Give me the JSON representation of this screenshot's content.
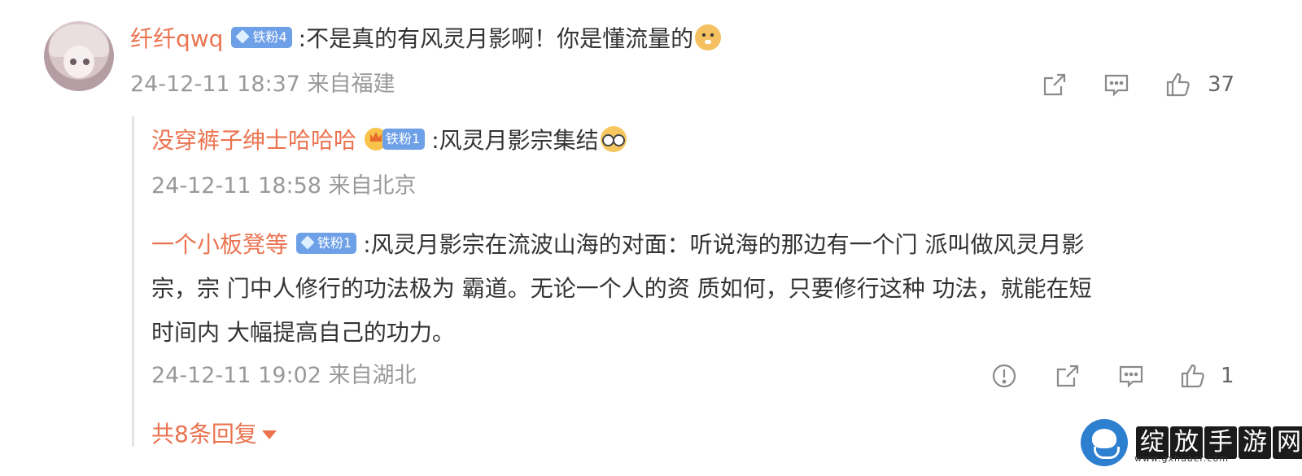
{
  "comment": {
    "username": "纤纤qwq",
    "badge": "铁粉4",
    "text": ":不是真的有风灵月影啊！你是懂流量的",
    "meta": "24-12-11 18:37 来自福建",
    "like_count": "37"
  },
  "replies": [
    {
      "username": "没穿裤子绅士哈哈哈",
      "badge": "铁粉1",
      "text": ":风灵月影宗集结",
      "meta": "24-12-11 18:58 来自北京"
    },
    {
      "username": "一个小板凳等",
      "badge": "铁粉1",
      "text_lines": [
        ":风灵月影宗在流波山海的对面：听说海的那边有一个门 派叫做风灵月影",
        "宗，宗 门中人修行的功法极为 霸道。无论一个人的资 质如何，只要修行这种 功法，就能在短",
        "时间内 大幅提高自己的功力。"
      ],
      "meta": "24-12-11 19:02 来自湖北",
      "like_count": "1"
    }
  ],
  "more_replies": "共8条回复",
  "watermark": {
    "text": [
      "绽",
      "放",
      "手",
      "游",
      "网"
    ],
    "url": "www.gxhuaer.com"
  },
  "icons": [
    "share-icon",
    "comment-icon",
    "like-icon",
    "report-icon"
  ],
  "colors": {
    "username": "#eb7350",
    "badge": "#6ea0e8",
    "meta": "#999999",
    "text": "#333333"
  }
}
